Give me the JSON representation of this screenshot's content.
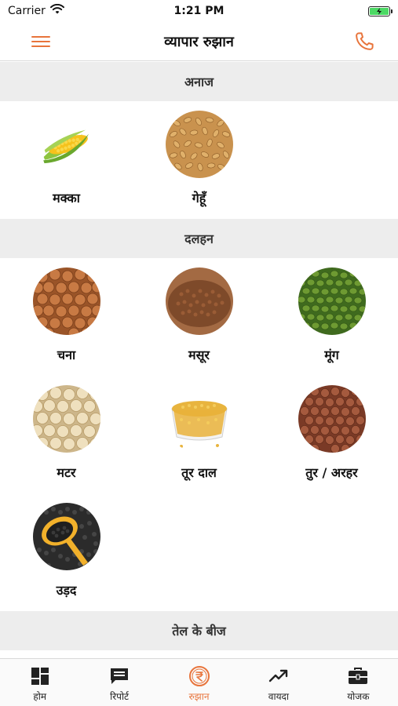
{
  "status_bar": {
    "carrier": "Carrier",
    "time": "1:21 PM"
  },
  "header": {
    "title": "व्यापार रुझान"
  },
  "sections": [
    {
      "title": "अनाज",
      "items": [
        {
          "label": "मक्का"
        },
        {
          "label": "गेहूँ"
        }
      ]
    },
    {
      "title": "दलहन",
      "items": [
        {
          "label": "चना"
        },
        {
          "label": "मसूर"
        },
        {
          "label": "मूंग"
        },
        {
          "label": "मटर"
        },
        {
          "label": "तूर दाल"
        },
        {
          "label": "तुर / अरहर"
        },
        {
          "label": "उड़द"
        }
      ]
    },
    {
      "title": "तेल के बीज"
    }
  ],
  "tabs": [
    {
      "label": "होम",
      "icon": "dashboard-icon"
    },
    {
      "label": "रिपोर्ट",
      "icon": "report-icon"
    },
    {
      "label": "रुझान",
      "icon": "rupee-icon",
      "active": true
    },
    {
      "label": "वायदा",
      "icon": "trend-icon"
    },
    {
      "label": "योजक",
      "icon": "briefcase-icon"
    }
  ],
  "colors": {
    "accent": "#e8743b",
    "section_bg": "#ededed",
    "divider": "#d9d9d9"
  }
}
